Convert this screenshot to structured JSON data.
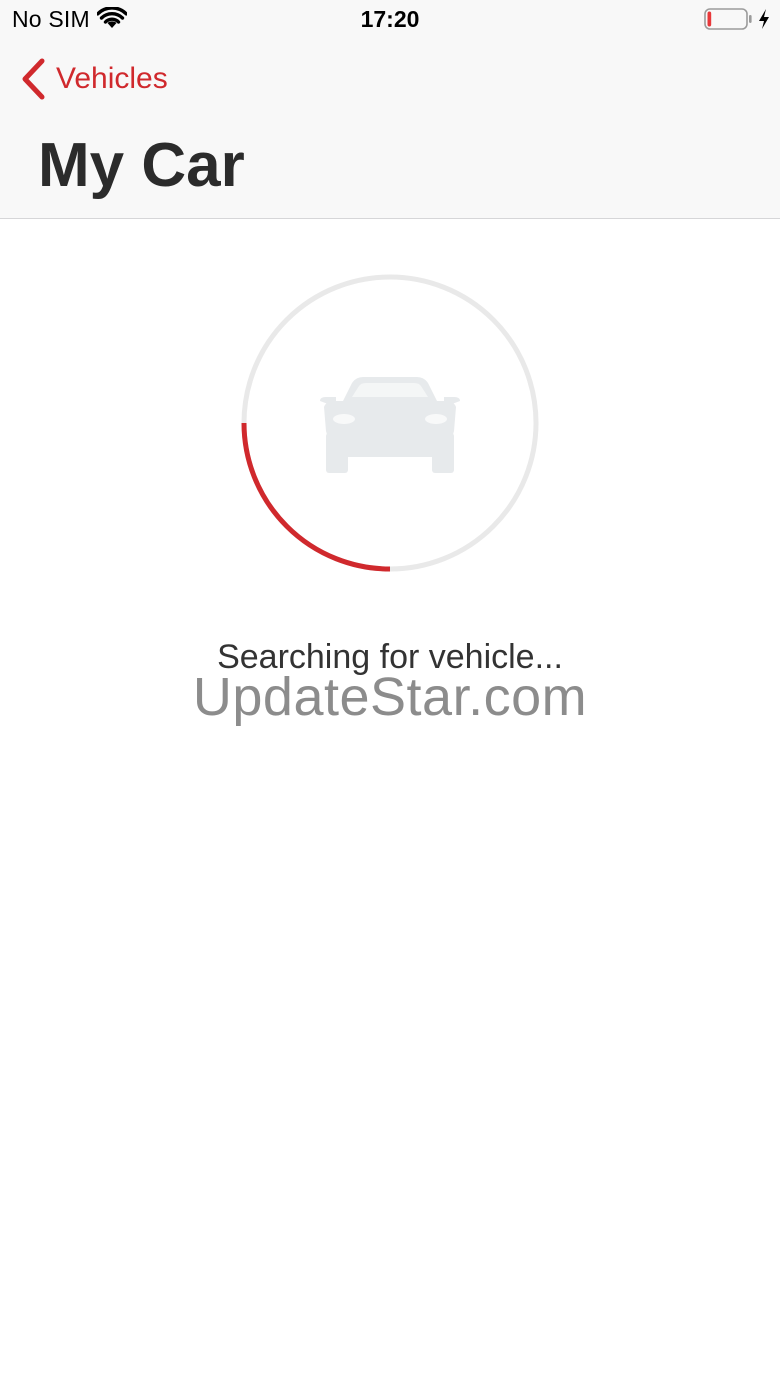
{
  "status_bar": {
    "carrier": "No SIM",
    "time": "17:20",
    "wifi_icon": "wifi-icon",
    "battery_icon": "battery-low-charging-icon",
    "battery_level": 0.1
  },
  "nav": {
    "back_label": "Vehicles",
    "back_icon": "chevron-left-icon",
    "title": "My Car"
  },
  "main": {
    "vehicle_icon": "car-icon",
    "progress": 0.25,
    "status_text": "Searching for vehicle...",
    "watermark": "UpdateStar.com"
  },
  "colors": {
    "accent": "#d0292d",
    "track": "#e9e9e9",
    "car_icon": "#e7eaec"
  }
}
